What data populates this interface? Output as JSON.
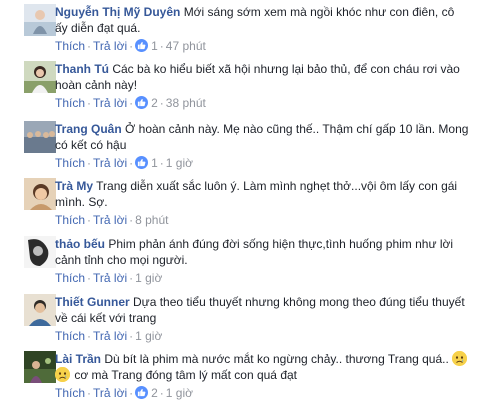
{
  "comments": [
    {
      "name": "Nguyễn Thị Mỹ Duyên",
      "text": "Mới sáng sớm xem mà ngồi khóc như con điên, cô ấy diễn đạt quá.",
      "like_label": "Thích",
      "reply_label": "Trả lời",
      "like_count": "1",
      "time": "47 phút",
      "avatar": "avatar-photo-beach",
      "avatar_color": "#b8c9d8"
    },
    {
      "name": "Thanh Tú",
      "text": "Các bà ko hiểu biết xã hội nhưng lại bảo thủ, để con cháu rơi vào hoàn cảnh này!",
      "like_label": "Thích",
      "reply_label": "Trả lời",
      "like_count": "2",
      "time": "38 phút",
      "avatar": "avatar-photo-woman",
      "avatar_color": "#8aa06a"
    },
    {
      "name": "Trang Quân",
      "text": "Ở hoàn cảnh này. Mẹ nào cũng thế.. Thậm chí gấp 10 lần. Mong có kết có hậu",
      "like_label": "Thích",
      "reply_label": "Trả lời",
      "like_count": "1",
      "time": "1 giờ",
      "avatar": "avatar-photo-crowd",
      "avatar_color": "#6a7a8e"
    },
    {
      "name": "Trà My",
      "text": "Trang diễn xuất sắc luôn ý. Làm mình nghẹt thở...vội ôm lấy con gái mình. Sợ.",
      "like_label": "Thích",
      "reply_label": "Trả lời",
      "like_count": "",
      "time": "8 phút",
      "avatar": "avatar-photo-child",
      "avatar_color": "#c79a6c"
    },
    {
      "name": "thảo bếu",
      "text": "Phim phản ánh đúng đời sống hiện thực,tình huống phim như lời cảnh tỉnh cho mọi người.",
      "like_label": "Thích",
      "reply_label": "Trả lời",
      "like_count": "",
      "time": "1 giờ",
      "avatar": "avatar-photo-portrait-bw",
      "avatar_color": "#3c3c3c"
    },
    {
      "name": "Thiết Gunner",
      "text": "Dựa theo tiểu thuyết nhưng không mong theo đúng tiểu thuyết về cái kết với trang",
      "like_label": "Thích",
      "reply_label": "Trả lời",
      "like_count": "",
      "time": "1 giờ",
      "avatar": "avatar-photo-man",
      "avatar_color": "#c9b89a"
    },
    {
      "name": "Lài Trần",
      "text": "Dù bít là phim mà nước mắt ko ngừng chảy.. thương Trang quá..",
      "text2": "cơ mà Trang đóng tâm lý mất con quá đạt",
      "emojis": [
        "crying-face-emoji",
        "crying-face-emoji"
      ],
      "like_label": "Thích",
      "reply_label": "Trả lời",
      "like_count": "2",
      "time": "1 giờ",
      "avatar": "avatar-photo-green",
      "avatar_color": "#4f6b3a"
    }
  ],
  "colors": {
    "name": "#365899",
    "text": "#1d2129",
    "link": "#4267b2",
    "meta": "#90949c",
    "like_badge": "#5890ff"
  }
}
